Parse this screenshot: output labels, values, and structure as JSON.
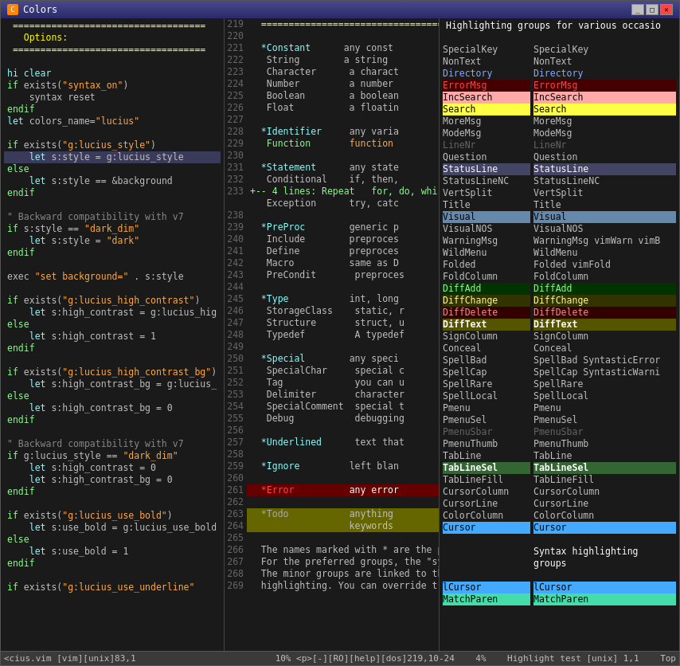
{
  "window": {
    "title": "Colors",
    "icon": "C"
  },
  "statusBar": {
    "left": "<cius.vim [vim][unix]83,1",
    "middle": "10%  <p>[-][RO][help][dos]219,10-24",
    "right_pct": "4%",
    "right2": "Highlight test [unix] 1,1",
    "top": "Top"
  },
  "leftPane": {
    "lines": [
      "===================================",
      "  Options:",
      "===================================",
      "",
      "hi clear",
      "if exists(\"syntax_on\")",
      "    syntax reset",
      "endif",
      "let colors_name=\"lucius\"",
      "",
      "if exists(\"g:lucius_style\")",
      "    let s:style = g:lucius_style",
      "else",
      "    let s:style == &background",
      "endif",
      "",
      "\" Backward compatibility with v7",
      "if s:style == \"dark_dim\"",
      "    let s:style = \"dark\"",
      "endif",
      "",
      "exec \"set background=\" . s:style",
      "",
      "if exists(\"g:lucius_high_contrast\")",
      "    let s:high_contrast = g:lucius_hig",
      "else",
      "    let s:high_contrast = 1",
      "endif",
      "",
      "if exists(\"g:lucius_high_contrast_bg\")",
      "    let s:high_contrast_bg = g:lucius_",
      "else",
      "    let s:high_contrast_bg = 0",
      "endif",
      "",
      "\" Backward compatibility with v7",
      "if g:lucius_style == \"dark_dim\"",
      "    let s:high_contrast = 0",
      "    let s:high_contrast_bg = 0",
      "endif",
      "",
      "if exists(\"g:lucius_use_bold\")",
      "    let s:use_bold = g:lucius_use_bold",
      "else",
      "    let s:use_bold = 1",
      "endif",
      "",
      "if exists(\"g:lucius_use_underline\""
    ]
  },
  "middlePane": {
    "startLine": 219,
    "lines": [
      {
        "n": 219,
        "code": "  ==================================="
      },
      {
        "n": 220,
        "code": ""
      },
      {
        "n": 221,
        "code": "  *Constant      any const"
      },
      {
        "n": 222,
        "code": "   String        a string"
      },
      {
        "n": 223,
        "code": "   Character      a charact"
      },
      {
        "n": 224,
        "code": "   Number         a number"
      },
      {
        "n": 225,
        "code": "   Boolean        a boolean"
      },
      {
        "n": 226,
        "code": "   Float          a floatin"
      },
      {
        "n": 227,
        "code": ""
      },
      {
        "n": 228,
        "code": "  *Identifier     any varia"
      },
      {
        "n": 229,
        "code": "   Function       function "
      },
      {
        "n": 230,
        "code": ""
      },
      {
        "n": 231,
        "code": "  *Statement      any state"
      },
      {
        "n": 232,
        "code": "   Conditional    if, then,"
      },
      {
        "n": 233,
        "code": "+-- 4 lines: Repeat   for, do, whi"
      },
      {
        "n": "",
        "code": "   Exception      try, catc"
      },
      {
        "n": 238,
        "code": ""
      },
      {
        "n": 239,
        "code": "  *PreProc        generic p"
      },
      {
        "n": 240,
        "code": "   Include        preproces"
      },
      {
        "n": 241,
        "code": "   Define         preproces"
      },
      {
        "n": 242,
        "code": "   Macro          same as D"
      },
      {
        "n": 243,
        "code": "   PreCondit       preproces"
      },
      {
        "n": 244,
        "code": ""
      },
      {
        "n": 245,
        "code": "  *Type           int, long"
      },
      {
        "n": 246,
        "code": "   StorageClass    static, r"
      },
      {
        "n": 247,
        "code": "   Structure       struct, u"
      },
      {
        "n": 248,
        "code": "   Typedef         A typedef"
      },
      {
        "n": 249,
        "code": ""
      },
      {
        "n": 250,
        "code": "  *Special        any speci"
      },
      {
        "n": 251,
        "code": "   SpecialChar     special c"
      },
      {
        "n": 252,
        "code": "   Tag             you can u"
      },
      {
        "n": 253,
        "code": "   Delimiter       character"
      },
      {
        "n": 254,
        "code": "   SpecialComment  special t"
      },
      {
        "n": 255,
        "code": "   Debug           debugging"
      },
      {
        "n": 256,
        "code": ""
      },
      {
        "n": 257,
        "code": "  *Underlined      text that"
      },
      {
        "n": 258,
        "code": ""
      },
      {
        "n": 259,
        "code": "  *Ignore         left blan"
      },
      {
        "n": 260,
        "code": ""
      },
      {
        "n": 261,
        "code": "  *Error          any error"
      },
      {
        "n": 262,
        "code": ""
      },
      {
        "n": 263,
        "code": "  *Todo           anything"
      },
      {
        "n": 264,
        "code": "                  keywords"
      },
      {
        "n": 265,
        "code": ""
      },
      {
        "n": 266,
        "code": "  The names marked with * are the p"
      },
      {
        "n": 267,
        "code": "  For the preferred groups, the \"sy"
      },
      {
        "n": 268,
        "code": "  The minor groups are linked to th"
      },
      {
        "n": 269,
        "code": "  highlighting. You can override t"
      }
    ]
  },
  "rightPane": {
    "title": "Highlighting groups for various occasio",
    "rows": [
      {
        "col1": "SpecialKey",
        "col2": "SpecialKey",
        "style1": "",
        "style2": ""
      },
      {
        "col1": "NonText",
        "col2": "NonText",
        "style1": "",
        "style2": ""
      },
      {
        "col1": "Directory",
        "col2": "Directory",
        "style1": "directory",
        "style2": "directory"
      },
      {
        "col1": "ErrorMsg",
        "col2": "ErrorMsg",
        "style1": "errormsg",
        "style2": "errormsg"
      },
      {
        "col1": "IncSearch",
        "col2": "IncSearch",
        "style1": "incsearch",
        "style2": "incsearch"
      },
      {
        "col1": "Search",
        "col2": "Search",
        "style1": "search",
        "style2": "search"
      },
      {
        "col1": "MoreMsg",
        "col2": "MoreMsg",
        "style1": "",
        "style2": ""
      },
      {
        "col1": "ModeMsg",
        "col2": "ModeMsg",
        "style1": "",
        "style2": ""
      },
      {
        "col1": "LineNr",
        "col2": "LineNr",
        "style1": "dim",
        "style2": "dim"
      },
      {
        "col1": "Question",
        "col2": "Question",
        "style1": "",
        "style2": ""
      },
      {
        "col1": "StatusLine",
        "col2": "StatusLine",
        "style1": "statusline",
        "style2": "statusline"
      },
      {
        "col1": "StatusLineNC",
        "col2": "StatusLineNC",
        "style1": "",
        "style2": ""
      },
      {
        "col1": "VertSplit",
        "col2": "VertSplit",
        "style1": "",
        "style2": ""
      },
      {
        "col1": "Title",
        "col2": "Title",
        "style1": "",
        "style2": ""
      },
      {
        "col1": "Visual",
        "col2": "Visual",
        "style1": "visual",
        "style2": "visual"
      },
      {
        "col1": "VisualNOS",
        "col2": "VisualNOS",
        "style1": "",
        "style2": ""
      },
      {
        "col1": "WarningMsg",
        "col2": "WarningMsg vimWarn vimB",
        "style1": "",
        "style2": ""
      },
      {
        "col1": "WildMenu",
        "col2": "WildMenu",
        "style1": "",
        "style2": ""
      },
      {
        "col1": "Folded",
        "col2": "Folded vimFold",
        "style1": "",
        "style2": ""
      },
      {
        "col1": "FoldColumn",
        "col2": "FoldColumn",
        "style1": "",
        "style2": ""
      },
      {
        "col1": "DiffAdd",
        "col2": "DiffAdd",
        "style1": "diffadd",
        "style2": "diffadd"
      },
      {
        "col1": "DiffChange",
        "col2": "DiffChange",
        "style1": "diffchange",
        "style2": "diffchange"
      },
      {
        "col1": "DiffDelete",
        "col2": "DiffDelete",
        "style1": "diffdelete",
        "style2": "diffdelete"
      },
      {
        "col1": "DiffText",
        "col2": "DiffText",
        "style1": "difftext",
        "style2": "difftext"
      },
      {
        "col1": "SignColumn",
        "col2": "SignColumn",
        "style1": "",
        "style2": ""
      },
      {
        "col1": "Conceal",
        "col2": "Conceal",
        "style1": "",
        "style2": ""
      },
      {
        "col1": "SpellBad",
        "col2": "SpellBad SyntasticError",
        "style1": "",
        "style2": ""
      },
      {
        "col1": "SpellCap",
        "col2": "SpellCap SyntasticWarni",
        "style1": "",
        "style2": ""
      },
      {
        "col1": "SpellRare",
        "col2": "SpellRare",
        "style1": "",
        "style2": ""
      },
      {
        "col1": "SpellLocal",
        "col2": "SpellLocal",
        "style1": "",
        "style2": ""
      },
      {
        "col1": "Pmenu",
        "col2": "Pmenu",
        "style1": "",
        "style2": ""
      },
      {
        "col1": "PmenuSel",
        "col2": "PmenuSel",
        "style1": "",
        "style2": ""
      },
      {
        "col1": "PmenuSbar",
        "col2": "PmenuSbar",
        "style1": "dim",
        "style2": "dim"
      },
      {
        "col1": "PmenuThumb",
        "col2": "PmenuThumb",
        "style1": "",
        "style2": ""
      },
      {
        "col1": "TabLine",
        "col2": "TabLine",
        "style1": "",
        "style2": ""
      },
      {
        "col1": "TabLineSel",
        "col2": "TabLineSel",
        "style1": "tablinesel",
        "style2": "tablinesel"
      },
      {
        "col1": "TabLineFill",
        "col2": "TabLineFill",
        "style1": "",
        "style2": ""
      },
      {
        "col1": "CursorColumn",
        "col2": "CursorColumn",
        "style1": "",
        "style2": ""
      },
      {
        "col1": "CursorLine",
        "col2": "CursorLine",
        "style1": "",
        "style2": ""
      },
      {
        "col1": "ColorColumn",
        "col2": "ColorColumn",
        "style1": "",
        "style2": ""
      },
      {
        "col1": "Cursor",
        "col2": "Cursor",
        "style1": "cursor",
        "style2": "cursor"
      },
      {
        "col1": "",
        "col2": "",
        "style1": "",
        "style2": ""
      },
      {
        "col1": "",
        "col2": "Syntax highlighting groups",
        "style1": "",
        "style2": "sectionheader"
      },
      {
        "col1": "",
        "col2": "",
        "style1": "",
        "style2": ""
      },
      {
        "col1": "lCursor",
        "col2": "lCursor",
        "style1": "cursor",
        "style2": "cursor"
      },
      {
        "col1": "MatchParen",
        "col2": "MatchParen",
        "style1": "matchparen",
        "style2": "matchparen"
      }
    ]
  }
}
